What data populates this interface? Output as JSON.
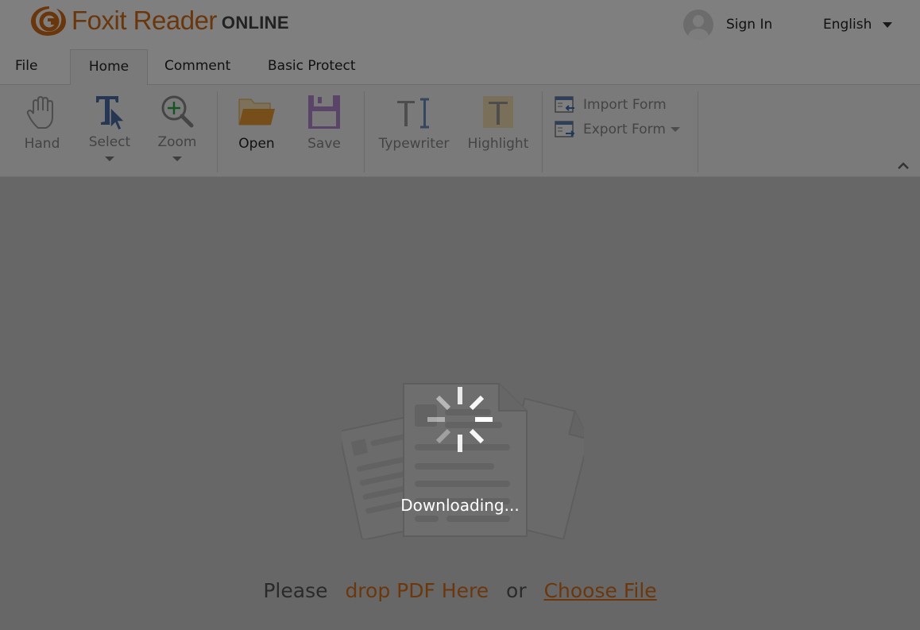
{
  "header": {
    "logo_text": "Foxit Reader",
    "logo_sub": "ONLINE",
    "signin_label": "Sign In",
    "language": "English"
  },
  "tabs": [
    {
      "label": "File",
      "active": false
    },
    {
      "label": "Home",
      "active": true
    },
    {
      "label": "Comment",
      "active": false
    },
    {
      "label": "Basic Protect",
      "active": false
    }
  ],
  "ribbon": {
    "hand": "Hand",
    "select": "Select",
    "zoom": "Zoom",
    "open": "Open",
    "save": "Save",
    "typewriter": "Typewriter",
    "highlight": "Highlight",
    "import_form": "Import Form",
    "export_form": "Export Form"
  },
  "main": {
    "please": "Please",
    "drop": "drop PDF Here",
    "or": "or",
    "choose": "Choose File"
  },
  "loading": {
    "text": "Downloading..."
  },
  "colors": {
    "brand": "#d46f1a",
    "overlay": "rgba(0,0,0,0.5)"
  }
}
